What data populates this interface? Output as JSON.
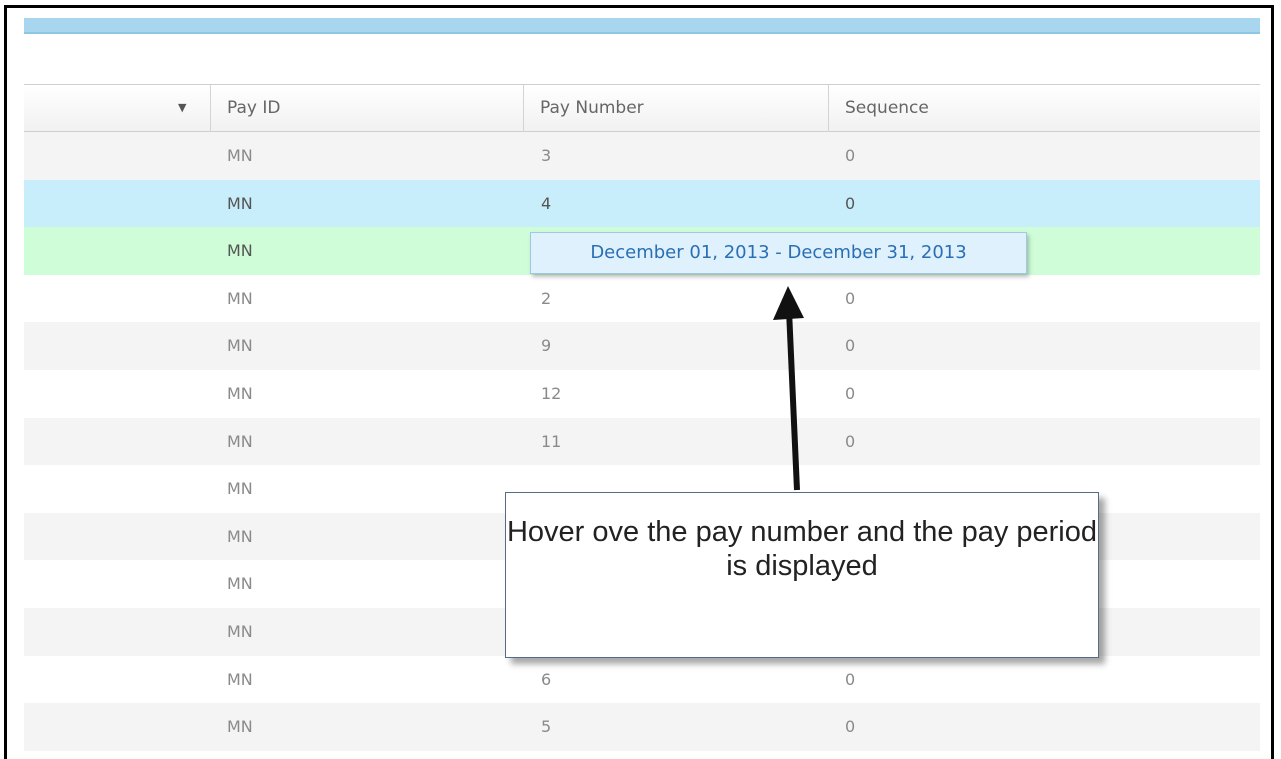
{
  "grid": {
    "columns": [
      "Pay ID",
      "Pay Number",
      "Sequence"
    ],
    "sort_icon": "sort-down-icon",
    "rows": [
      {
        "pay_id": "MN",
        "pay_number": "3",
        "sequence": "0"
      },
      {
        "pay_id": "MN",
        "pay_number": "4",
        "sequence": "0"
      },
      {
        "pay_id": "MN",
        "pay_number": "",
        "sequence": ""
      },
      {
        "pay_id": "MN",
        "pay_number": "2",
        "sequence": "0"
      },
      {
        "pay_id": "MN",
        "pay_number": "9",
        "sequence": "0"
      },
      {
        "pay_id": "MN",
        "pay_number": "12",
        "sequence": "0"
      },
      {
        "pay_id": "MN",
        "pay_number": "11",
        "sequence": "0"
      },
      {
        "pay_id": "MN",
        "pay_number": "",
        "sequence": ""
      },
      {
        "pay_id": "MN",
        "pay_number": "",
        "sequence": ""
      },
      {
        "pay_id": "MN",
        "pay_number": "",
        "sequence": ""
      },
      {
        "pay_id": "MN",
        "pay_number": "",
        "sequence": ""
      },
      {
        "pay_id": "MN",
        "pay_number": "6",
        "sequence": "0"
      },
      {
        "pay_id": "MN",
        "pay_number": "5",
        "sequence": "0"
      }
    ]
  },
  "tooltip": {
    "text": "December 01, 2013 - December 31, 2013"
  },
  "callout": {
    "text": "Hover ove the pay number and the pay period is displayed"
  },
  "colors": {
    "selected_row": "#c9eefb",
    "hover_row": "#cffdd8",
    "tooltip_text": "#2a6fb4"
  }
}
